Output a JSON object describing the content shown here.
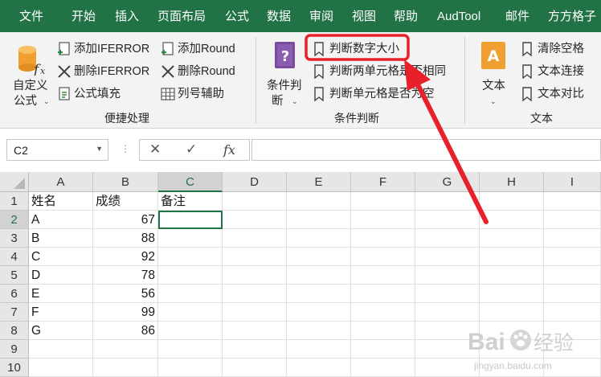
{
  "tabs": [
    "文件",
    "开始",
    "插入",
    "页面布局",
    "公式",
    "数据",
    "审阅",
    "视图",
    "帮助",
    "AudTool",
    "邮件",
    "方方格子"
  ],
  "ribbon": {
    "custom_formula": {
      "line1": "自定义",
      "line2": "公式"
    },
    "quick_group": {
      "label": "便捷处理",
      "add_iferror": "添加IFERROR",
      "remove_iferror": "删除IFERROR",
      "formula_fill": "公式填充",
      "add_round": "添加Round",
      "remove_round": "删除Round",
      "column_helper": "列号辅助"
    },
    "condition_group": {
      "label": "条件判断",
      "button_line1": "条件判",
      "button_line2": "断",
      "compare_numbers": "判断数字大小",
      "two_cells_same": "判断两单元格是否相同",
      "cell_empty": "判断单元格是否为空"
    },
    "text_group": {
      "label": "文本",
      "text_button": "文本",
      "clear_spaces": "清除空格",
      "text_join": "文本连接",
      "text_compare": "文本对比"
    }
  },
  "formula_bar": {
    "name_box": "C2",
    "cancel_symbol": "✕",
    "enter_symbol": "✓",
    "fx_symbol": "fx",
    "formula": ""
  },
  "columns": [
    "A",
    "B",
    "C",
    "D",
    "E",
    "F",
    "G",
    "H",
    "I"
  ],
  "rows": [
    "1",
    "2",
    "3",
    "4",
    "5",
    "6",
    "7",
    "8",
    "9",
    "10"
  ],
  "sheet": {
    "headers": [
      "姓名",
      "成绩",
      "备注"
    ],
    "records": [
      {
        "name": "A",
        "score": "67"
      },
      {
        "name": "B",
        "score": "88"
      },
      {
        "name": "C",
        "score": "92"
      },
      {
        "name": "D",
        "score": "78"
      },
      {
        "name": "E",
        "score": "56"
      },
      {
        "name": "F",
        "score": "99"
      },
      {
        "name": "G",
        "score": "86"
      }
    ]
  },
  "watermark": {
    "brand": "Bai",
    "brand_cn": "经验",
    "url": "jingyan.baidu.com"
  },
  "colors": {
    "ribbon_green": "#217346",
    "highlight_red": "#e8202a",
    "icon_purple": "#7a4b9c",
    "icon_orange": "#f0a030"
  }
}
